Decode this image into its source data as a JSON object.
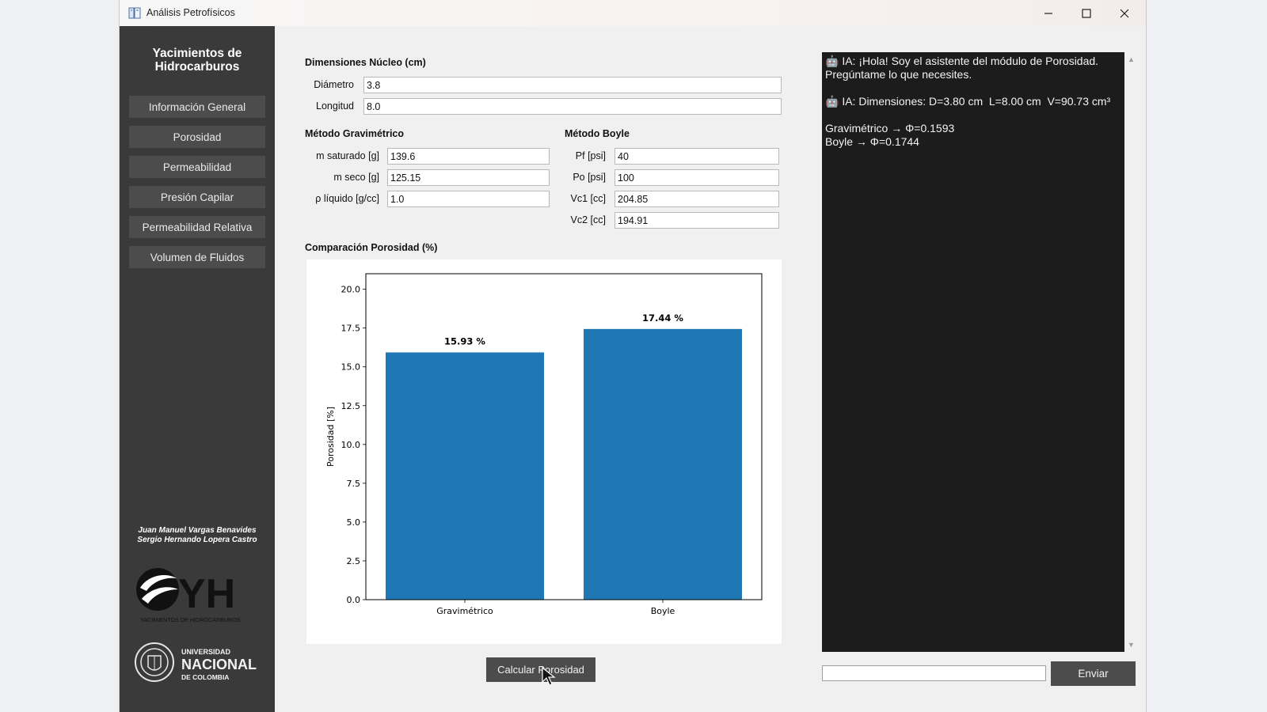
{
  "window": {
    "title": "Análisis Petrofísicos",
    "icon": "book-icon"
  },
  "sidebar": {
    "brand": "Yacimientos de\nHidrocarburos",
    "items": [
      {
        "label": "Información General"
      },
      {
        "label": "Porosidad"
      },
      {
        "label": "Permeabilidad"
      },
      {
        "label": "Presión Capilar"
      },
      {
        "label": "Permeabilidad Relativa"
      },
      {
        "label": "Volumen de Fluidos"
      }
    ],
    "authors": [
      "Juan Manuel Vargas Benavides",
      "Sergio Hernando Lopera Castro"
    ],
    "logo_yh": {
      "letters": "YH",
      "caption": "YACIMIENTOS DE HIDROCARBUROS"
    },
    "logo_un": {
      "line1": "UNIVERSIDAD",
      "line2": "NACIONAL",
      "line3": "DE COLOMBIA"
    }
  },
  "core": {
    "title": "Dimensiones Núcleo (cm)",
    "diameter_label": "Diámetro",
    "diameter_value": "3.8",
    "length_label": "Longitud",
    "length_value": "8.0"
  },
  "gravimetric": {
    "title": "Método Gravimétrico",
    "m_sat_label": "m saturado [g]",
    "m_sat_value": "139.6",
    "m_dry_label": "m seco [g]",
    "m_dry_value": "125.15",
    "rho_label": "ρ líquido [g/cc]",
    "rho_value": "1.0"
  },
  "boyle": {
    "title": "Método Boyle",
    "pf_label": "Pf [psi]",
    "pf_value": "40",
    "po_label": "Po [psi]",
    "po_value": "100",
    "vc1_label": "Vc1 [cc]",
    "vc1_value": "204.85",
    "vc2_label": "Vc2 [cc]",
    "vc2_value": "194.91"
  },
  "chart_section": {
    "title": "Comparación Porosidad (%)"
  },
  "chart_data": {
    "type": "bar",
    "categories": [
      "Gravimétrico",
      "Boyle"
    ],
    "values": [
      15.93,
      17.44
    ],
    "value_labels": [
      "15.93 %",
      "17.44 %"
    ],
    "ylabel": "Porosidad [%]",
    "ylim": [
      0,
      21
    ],
    "yticks": [
      "0.0",
      "2.5",
      "5.0",
      "7.5",
      "10.0",
      "12.5",
      "15.0",
      "17.5",
      "20.0"
    ],
    "bar_color": "#1f77b4",
    "grid": false
  },
  "actions": {
    "calculate": "Calcular Porosidad"
  },
  "chat": {
    "messages": "🤖 IA: ¡Hola! Soy el asistente del módulo de Porosidad. Pregúntame lo que necesites.\n\n🤖 IA: Dimensiones: D=3.80 cm  L=8.00 cm  V=90.73 cm³\n\nGravimétrico → Φ=0.1593\nBoyle → Φ=0.1744",
    "send_label": "Enviar",
    "input_value": ""
  }
}
